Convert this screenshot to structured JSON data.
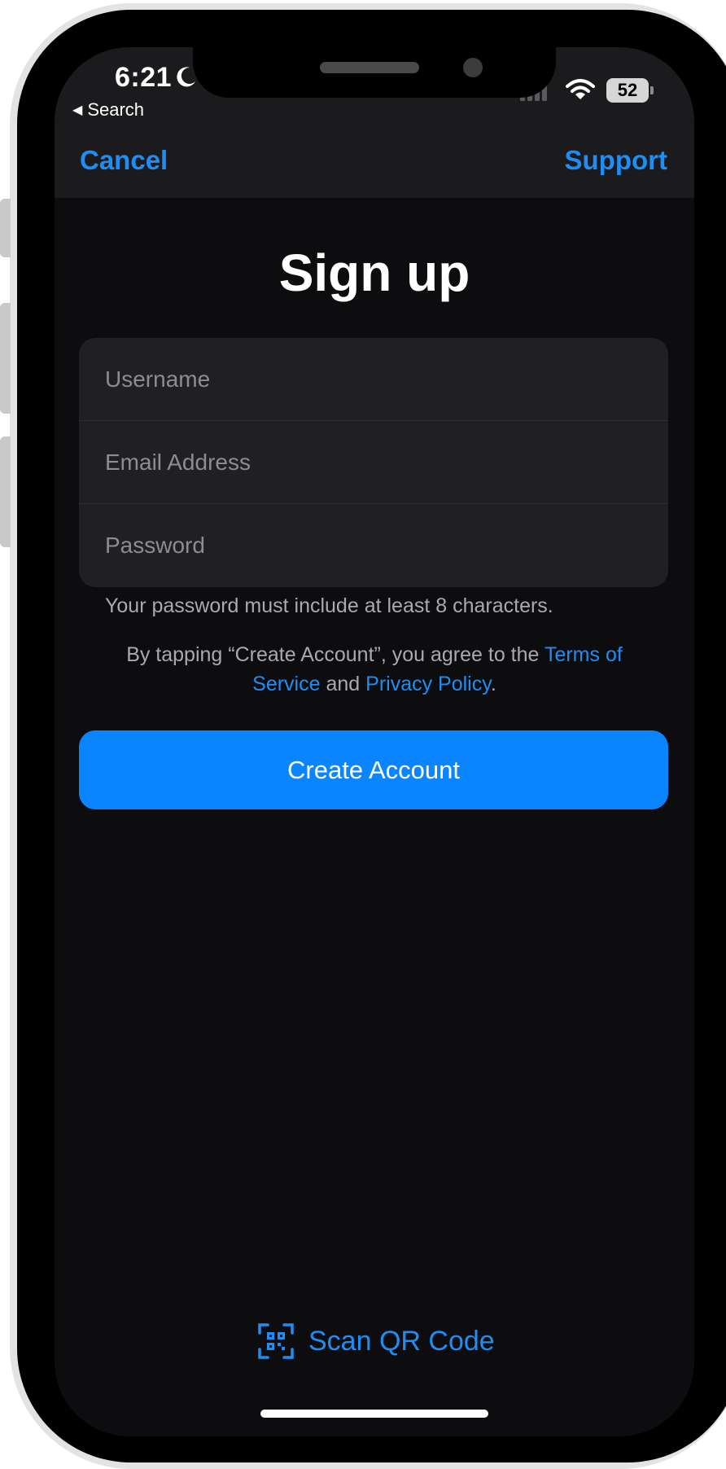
{
  "status_bar": {
    "time": "6:21",
    "back_label": "Search",
    "battery": "52"
  },
  "nav": {
    "cancel": "Cancel",
    "support": "Support"
  },
  "page": {
    "title": "Sign up"
  },
  "form": {
    "username_placeholder": "Username",
    "email_placeholder": "Email Address",
    "password_placeholder": "Password",
    "password_hint": "Your password must include at least 8 characters."
  },
  "terms": {
    "prefix": "By tapping “Create Account”, you agree to the ",
    "tos": "Terms of Service",
    "conjunction": " and ",
    "privacy": "Privacy Policy",
    "suffix": "."
  },
  "actions": {
    "create_account": "Create Account",
    "scan_qr": "Scan QR Code"
  },
  "colors": {
    "accent": "#1e8ef5",
    "button": "#0a84ff",
    "background": "#0d0d0f"
  },
  "icons": {
    "moon": "moon-icon",
    "signal": "cellular-signal-icon",
    "wifi": "wifi-icon",
    "battery": "battery-icon",
    "qr": "qr-code-icon"
  }
}
